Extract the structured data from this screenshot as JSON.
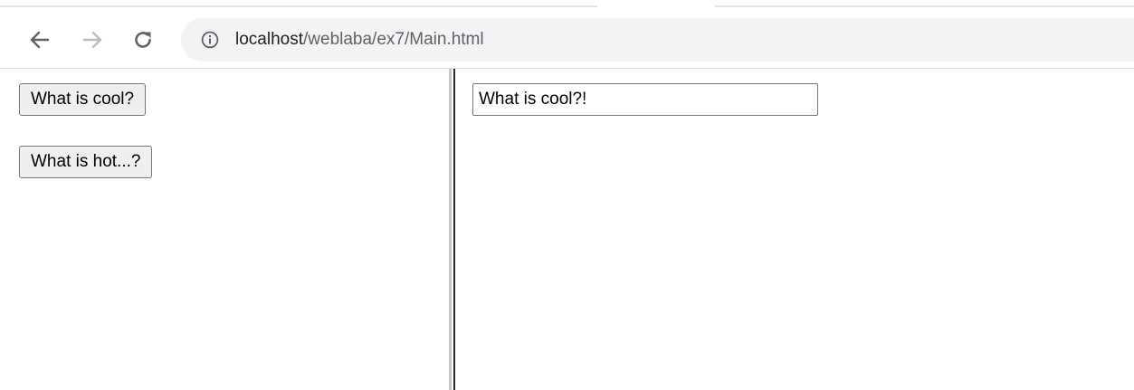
{
  "browser": {
    "url_host": "localhost",
    "url_path": "/weblaba/ex7/Main.html",
    "icons": {
      "back": "back-arrow-icon",
      "forward": "forward-arrow-icon",
      "reload": "reload-icon",
      "site_info": "info-icon"
    }
  },
  "left_frame": {
    "cool_button_label": "What is cool?",
    "hot_button_label": "What is hot...?"
  },
  "right_frame": {
    "output_value": "What is cool?!"
  }
}
